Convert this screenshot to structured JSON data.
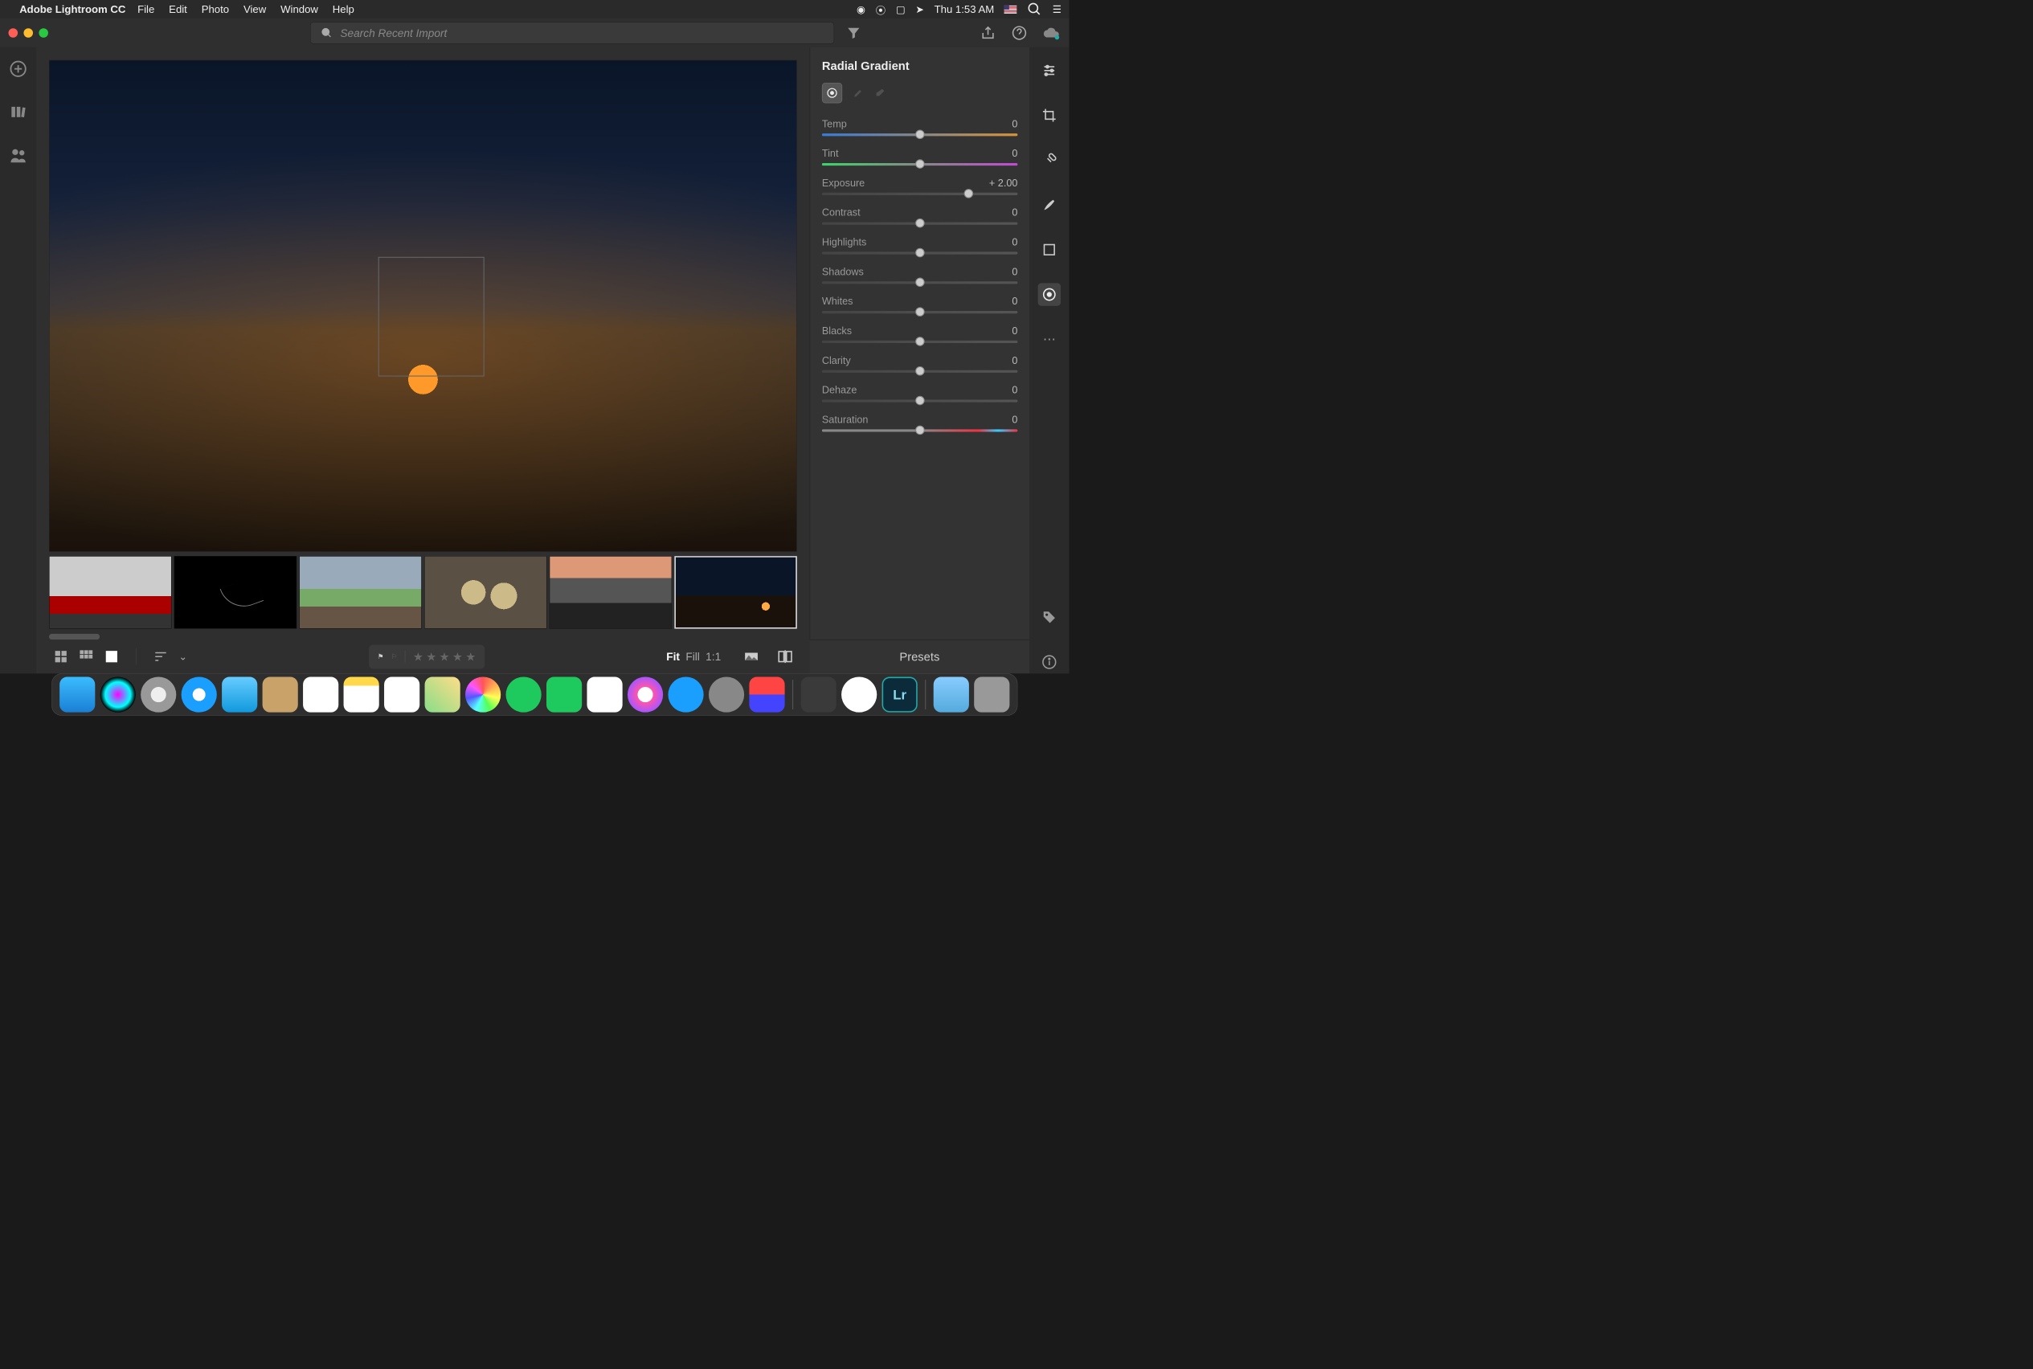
{
  "menubar": {
    "app_name": "Adobe Lightroom CC",
    "items": [
      "File",
      "Edit",
      "Photo",
      "View",
      "Window",
      "Help"
    ],
    "clock": "Thu 1:53 AM"
  },
  "search": {
    "placeholder": "Search Recent Import"
  },
  "panel": {
    "title": "Radial Gradient",
    "sliders": [
      {
        "name": "Temp",
        "value": "0",
        "pos": 50,
        "track": "temp"
      },
      {
        "name": "Tint",
        "value": "0",
        "pos": 50,
        "track": "tint"
      },
      {
        "name": "Exposure",
        "value": "+ 2.00",
        "pos": 75,
        "track": ""
      },
      {
        "name": "Contrast",
        "value": "0",
        "pos": 50,
        "track": ""
      },
      {
        "name": "Highlights",
        "value": "0",
        "pos": 50,
        "track": ""
      },
      {
        "name": "Shadows",
        "value": "0",
        "pos": 50,
        "track": ""
      },
      {
        "name": "Whites",
        "value": "0",
        "pos": 50,
        "track": ""
      },
      {
        "name": "Blacks",
        "value": "0",
        "pos": 50,
        "track": ""
      },
      {
        "name": "Clarity",
        "value": "0",
        "pos": 50,
        "track": ""
      },
      {
        "name": "Dehaze",
        "value": "0",
        "pos": 50,
        "track": ""
      },
      {
        "name": "Saturation",
        "value": "0",
        "pos": 50,
        "track": "sat"
      }
    ]
  },
  "bottom": {
    "fit": "Fit",
    "fill": "Fill",
    "ratio": "1:1",
    "presets": "Presets"
  }
}
